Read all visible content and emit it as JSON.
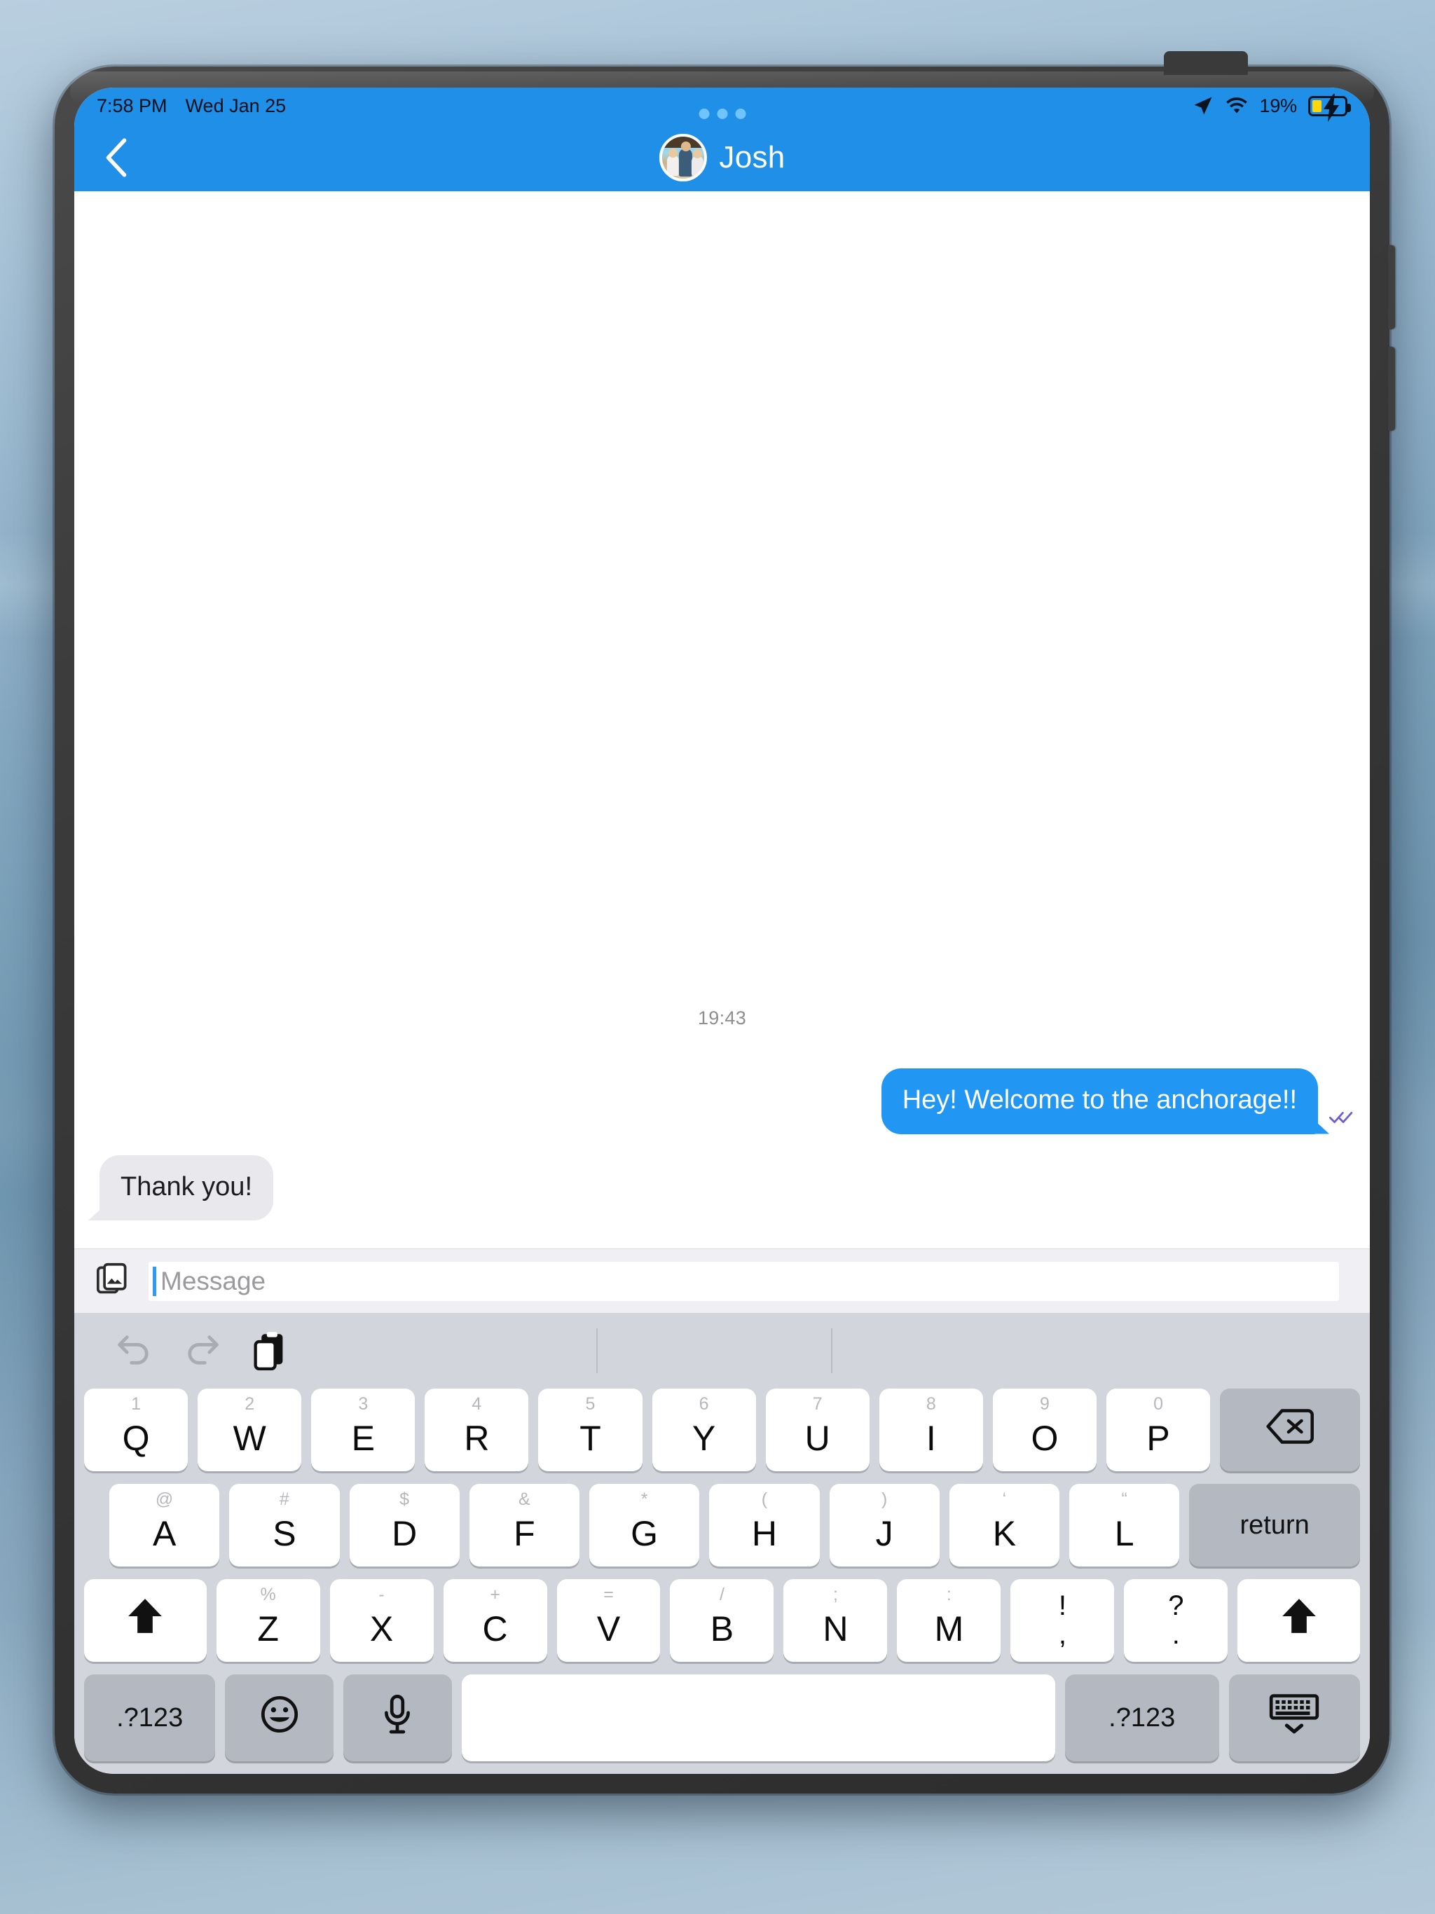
{
  "status_bar": {
    "time": "7:58 PM",
    "date": "Wed Jan 25",
    "battery_percent": "19%",
    "icons": [
      "location-arrow-icon",
      "wifi-icon",
      "battery-charging-icon"
    ],
    "accent_color": "#1f8fe8",
    "battery_level_color": "#ffd60a"
  },
  "nav_bar": {
    "back_label": "‹",
    "contact_name": "Josh",
    "avatar_name": "contact-avatar",
    "background_color": "#1f8fe8"
  },
  "conversation": {
    "timestamp": "19:43",
    "messages": [
      {
        "direction": "outgoing",
        "text": "Hey! Welcome to the anchorage!!",
        "status": "read",
        "bubble_color": "#2196f3"
      },
      {
        "direction": "incoming",
        "text": "Thank you!",
        "bubble_color": "#e8e8ed"
      }
    ]
  },
  "input_bar": {
    "attachment_icon": "photo-library-icon",
    "placeholder": "Message",
    "value": ""
  },
  "keyboard": {
    "tools": [
      "undo-icon",
      "redo-icon",
      "paste-icon"
    ],
    "row1": [
      {
        "sup": "1",
        "main": "Q"
      },
      {
        "sup": "2",
        "main": "W"
      },
      {
        "sup": "3",
        "main": "E"
      },
      {
        "sup": "4",
        "main": "R"
      },
      {
        "sup": "5",
        "main": "T"
      },
      {
        "sup": "6",
        "main": "Y"
      },
      {
        "sup": "7",
        "main": "U"
      },
      {
        "sup": "8",
        "main": "I"
      },
      {
        "sup": "9",
        "main": "O"
      },
      {
        "sup": "0",
        "main": "P"
      }
    ],
    "backspace_label": "backspace-icon",
    "row2": [
      {
        "sup": "@",
        "main": "A"
      },
      {
        "sup": "#",
        "main": "S"
      },
      {
        "sup": "$",
        "main": "D"
      },
      {
        "sup": "&",
        "main": "F"
      },
      {
        "sup": "*",
        "main": "G"
      },
      {
        "sup": "(",
        "main": "H"
      },
      {
        "sup": ")",
        "main": "J"
      },
      {
        "sup": "‘",
        "main": "K"
      },
      {
        "sup": "“",
        "main": "L"
      }
    ],
    "return_label": "return",
    "row3": [
      {
        "sup": "%",
        "main": "Z"
      },
      {
        "sup": "-",
        "main": "X"
      },
      {
        "sup": "+",
        "main": "C"
      },
      {
        "sup": "=",
        "main": "V"
      },
      {
        "sup": "/",
        "main": "B"
      },
      {
        "sup": ";",
        "main": "N"
      },
      {
        "sup": ":",
        "main": "M"
      }
    ],
    "punct_keys": [
      {
        "up": "!",
        "dn": ","
      },
      {
        "up": "?",
        "dn": "."
      }
    ],
    "shift_label": "shift-icon",
    "row4": {
      "numbers_left": ".?123",
      "emoji": "emoji-icon",
      "mic": "microphone-icon",
      "space": "",
      "numbers_right": ".?123",
      "hide": "hide-keyboard-icon"
    }
  }
}
